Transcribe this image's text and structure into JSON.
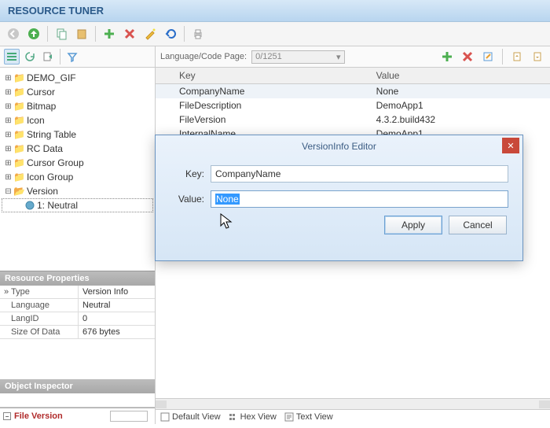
{
  "app": {
    "title": "RESOURCE TUNER"
  },
  "tree": {
    "items": [
      {
        "label": "DEMO_GIF"
      },
      {
        "label": "Cursor"
      },
      {
        "label": "Bitmap"
      },
      {
        "label": "Icon"
      },
      {
        "label": "String Table"
      },
      {
        "label": "RC Data"
      },
      {
        "label": "Cursor Group"
      },
      {
        "label": "Icon Group"
      },
      {
        "label": "Version",
        "open": true
      }
    ],
    "child": "1: Neutral"
  },
  "props": {
    "header": "Resource Properties",
    "rows": [
      {
        "k": "Type",
        "v": "Version Info"
      },
      {
        "k": "Language",
        "v": "Neutral"
      },
      {
        "k": "LangID",
        "v": "0"
      },
      {
        "k": "Size Of Data",
        "v": "676 bytes"
      }
    ]
  },
  "inspector": {
    "header": "Object Inspector"
  },
  "fileversion": {
    "label": "File Version"
  },
  "right": {
    "lang_label": "Language/Code Page:",
    "lang_value": "0/1251",
    "columns": {
      "key": "Key",
      "value": "Value"
    },
    "rows": [
      {
        "k": "CompanyName",
        "v": "None"
      },
      {
        "k": "FileDescription",
        "v": "DemoApp1"
      },
      {
        "k": "FileVersion",
        "v": "4.3.2.build432"
      },
      {
        "k": "InternalName",
        "v": "DemoApp1"
      }
    ]
  },
  "views": {
    "default": "Default View",
    "hex": "Hex View",
    "text": "Text View"
  },
  "dialog": {
    "title": "VersionInfo Editor",
    "key_label": "Key:",
    "key_value": "CompanyName",
    "value_label": "Value:",
    "value_value": "None",
    "apply": "Apply",
    "cancel": "Cancel"
  }
}
